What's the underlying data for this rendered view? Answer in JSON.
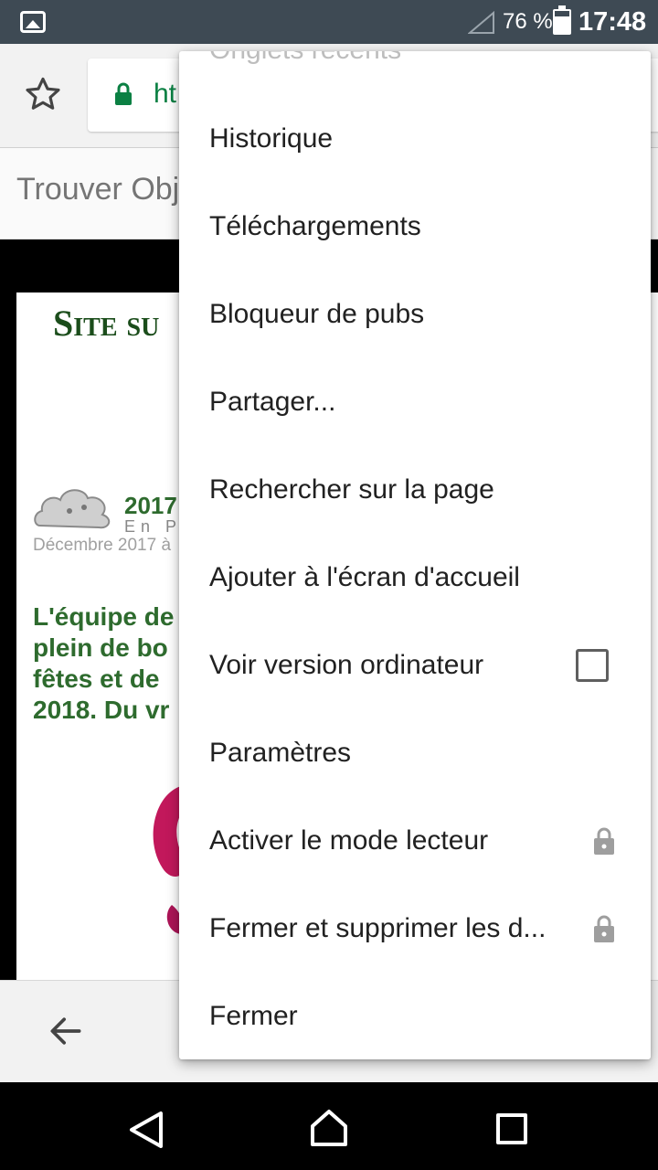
{
  "status_bar": {
    "battery_percent": "76 %",
    "time": "17:48",
    "icons": [
      "image-icon",
      "signal-icon",
      "battery-icon"
    ]
  },
  "browser": {
    "url_visible": "ht",
    "find_text": "Trouver Obj",
    "accent_url_color": "#0b8043"
  },
  "page": {
    "site_title": "Site su",
    "year_text": "2017",
    "enp_text": "En P",
    "date_text": "Décembre 2017 à",
    "paragraph_lines": [
      "L'équipe de",
      "plein de bo",
      "fêtes et de",
      "2018. Du vr"
    ]
  },
  "menu": {
    "partial_item": "Onglets récents",
    "items": [
      {
        "label": "Historique"
      },
      {
        "label": "Téléchargements"
      },
      {
        "label": "Bloqueur de pubs"
      },
      {
        "label": "Partager..."
      },
      {
        "label": "Rechercher sur la page"
      },
      {
        "label": "Ajouter à l'écran d'accueil"
      },
      {
        "label": "Voir version ordinateur",
        "checkbox": false
      },
      {
        "label": "Paramètres"
      },
      {
        "label": "Activer le mode lecteur",
        "icon": "lock-icon"
      },
      {
        "label": "Fermer et supprimer les d...",
        "icon": "lock-icon"
      },
      {
        "label": "Fermer"
      }
    ]
  },
  "nav": {
    "icons": [
      "nav-back-icon",
      "nav-home-icon",
      "nav-recent-icon"
    ]
  }
}
